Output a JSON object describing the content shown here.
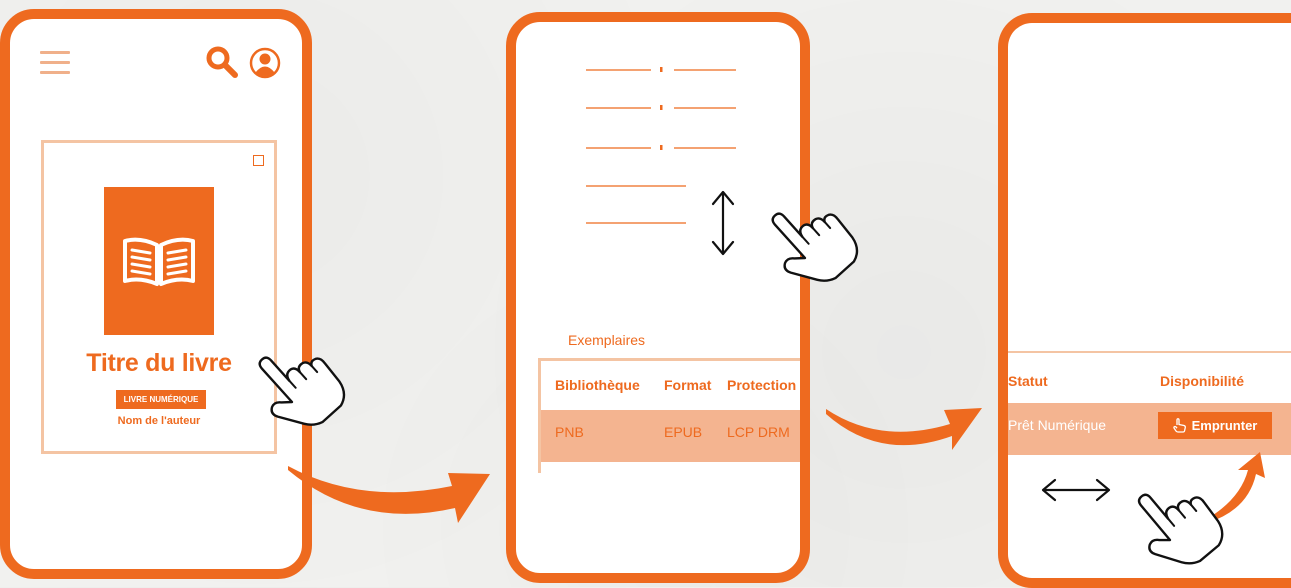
{
  "screen1": {
    "book": {
      "title": "Titre du livre",
      "type_badge": "LIVRE NUMÉRIQUE",
      "author": "Nom de l'auteur"
    },
    "icons": [
      "menu-icon",
      "search-icon",
      "account-icon",
      "checkbox-icon",
      "open-book-icon"
    ]
  },
  "screen2": {
    "copies_label": "Exemplaires",
    "table": {
      "headers": [
        "Bibliothèque",
        "Format",
        "Protection"
      ],
      "rows": [
        [
          "PNB",
          "EPUB",
          "LCP DRM"
        ]
      ]
    },
    "icons": [
      "vertical-scroll-arrow-icon",
      "pointing-hand-icon"
    ]
  },
  "screen3": {
    "table": {
      "headers": [
        "Statut",
        "Disponibilité"
      ],
      "rows": [
        [
          "Prêt Numérique"
        ]
      ]
    },
    "borrow_button": "Emprunter",
    "icons": [
      "horizontal-scroll-arrow-icon",
      "pointing-hand-icon",
      "hand-icon"
    ]
  },
  "colors": {
    "accent": "#ee6a1f",
    "accent_light": "#f4b490",
    "border_light": "#f4c4a3",
    "background": "#f1f1ef"
  }
}
